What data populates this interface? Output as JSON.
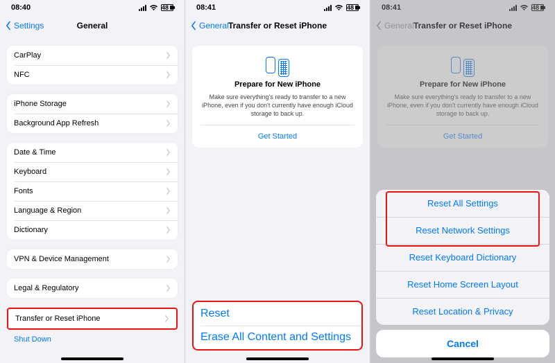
{
  "highlight_color": "#e11",
  "accent_color": "#007aff",
  "battery_level": "48",
  "screen1": {
    "time": "08:40",
    "back": "Settings",
    "title": "General",
    "groups": [
      {
        "rows": [
          {
            "label": "CarPlay"
          },
          {
            "label": "NFC"
          }
        ]
      },
      {
        "rows": [
          {
            "label": "iPhone Storage"
          },
          {
            "label": "Background App Refresh"
          }
        ]
      },
      {
        "rows": [
          {
            "label": "Date & Time"
          },
          {
            "label": "Keyboard"
          },
          {
            "label": "Fonts"
          },
          {
            "label": "Language & Region"
          },
          {
            "label": "Dictionary"
          }
        ]
      },
      {
        "rows": [
          {
            "label": "VPN & Device Management"
          }
        ]
      },
      {
        "rows": [
          {
            "label": "Legal & Regulatory"
          }
        ]
      },
      {
        "rows": [
          {
            "label": "Transfer or Reset iPhone"
          }
        ],
        "highlight": true
      }
    ],
    "shut_down": "Shut Down"
  },
  "screen2": {
    "time": "08:41",
    "back": "General",
    "title": "Transfer or Reset iPhone",
    "card": {
      "heading": "Prepare for New iPhone",
      "body": "Make sure everything's ready to transfer to a new iPhone, even if you don't currently have enough iCloud storage to back up.",
      "cta": "Get Started"
    },
    "bottom": {
      "reset": "Reset",
      "erase": "Erase All Content and Settings"
    }
  },
  "screen3": {
    "time": "08:41",
    "back": "General",
    "title": "Transfer or Reset iPhone",
    "card": {
      "heading": "Prepare for New iPhone",
      "body": "Make sure everything's ready to transfer to a new iPhone, even if you don't currently have enough iCloud storage to back up.",
      "cta": "Get Started"
    },
    "sheet": {
      "options": [
        "Reset All Settings",
        "Reset Network Settings",
        "Reset Keyboard Dictionary",
        "Reset Home Screen Layout",
        "Reset Location & Privacy"
      ],
      "cancel": "Cancel",
      "highlight_indices": [
        0,
        1
      ]
    }
  }
}
